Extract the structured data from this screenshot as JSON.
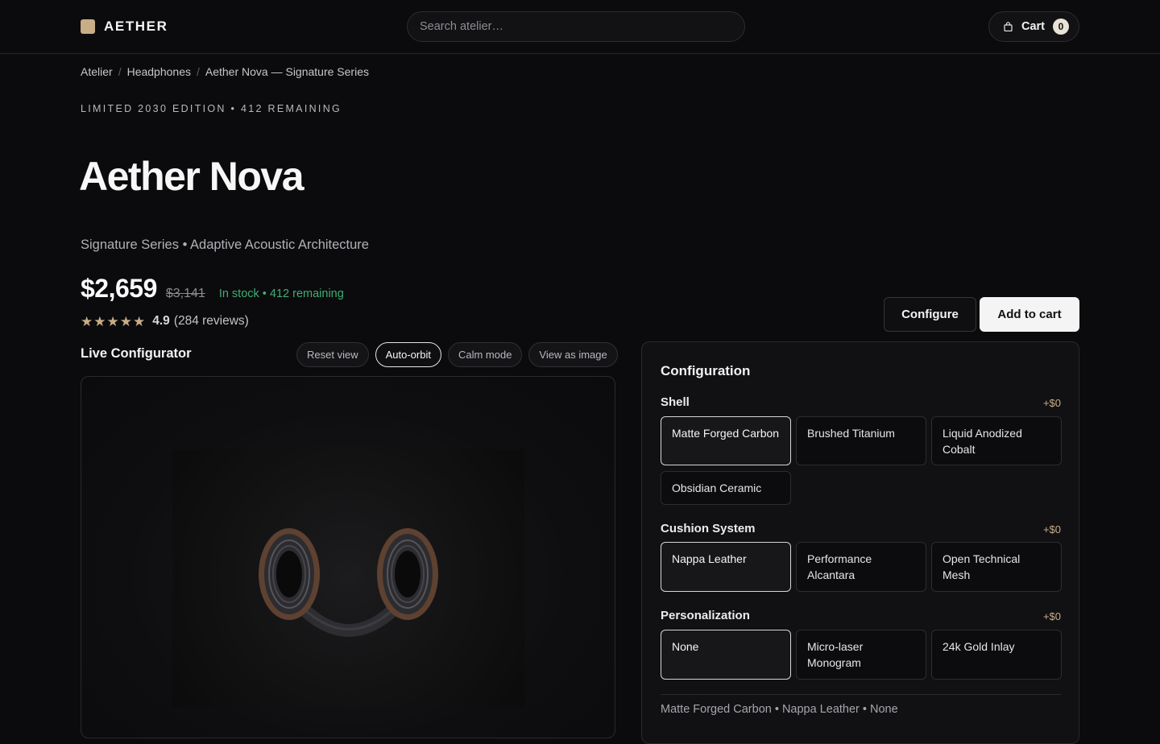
{
  "header": {
    "brand": "AETHER",
    "search_placeholder": "Search atelier…",
    "cart_label": "Cart",
    "cart_count": "0"
  },
  "breadcrumb": [
    "Atelier",
    "Headphones",
    "Aether Nova — Signature Series"
  ],
  "product": {
    "eyebrow": "LIMITED 2030 EDITION • 412 REMAINING",
    "title": "Aether Nova",
    "subtitle": "Signature Series • Adaptive Acoustic Architecture",
    "price": "$2,659",
    "original_price": "$3,141",
    "stock": "In stock • 412 remaining",
    "rating": "4.9",
    "rating_stars": 5,
    "reviews": "(284 reviews)"
  },
  "actions": {
    "configure": "Configure",
    "add_to_cart": "Add to cart"
  },
  "configurator": {
    "title": "Live Configurator",
    "controls": [
      "Reset view",
      "Auto-orbit",
      "Calm mode",
      "View as image"
    ],
    "active_control": "Auto-orbit"
  },
  "configuration": {
    "title": "Configuration",
    "groups": [
      {
        "label": "Shell",
        "price": "+$0",
        "options": [
          "Matte Forged Carbon",
          "Brushed Titanium",
          "Liquid Anodized Cobalt",
          "Obsidian Ceramic"
        ],
        "selected": "Matte Forged Carbon"
      },
      {
        "label": "Cushion System",
        "price": "+$0",
        "options": [
          "Nappa Leather",
          "Performance Alcantara",
          "Open Technical Mesh"
        ],
        "selected": "Nappa Leather"
      },
      {
        "label": "Personalization",
        "price": "+$0",
        "options": [
          "None",
          "Micro-laser Monogram",
          "24k Gold Inlay"
        ],
        "selected": "None"
      }
    ],
    "summary": "Matte Forged Carbon • Nappa Leather • None"
  },
  "colors": {
    "background": "#0b0b0d",
    "accent_gold": "#c9ad86",
    "stock_green": "#3fae73",
    "ear_cup_bronze": "#6b4a32"
  }
}
